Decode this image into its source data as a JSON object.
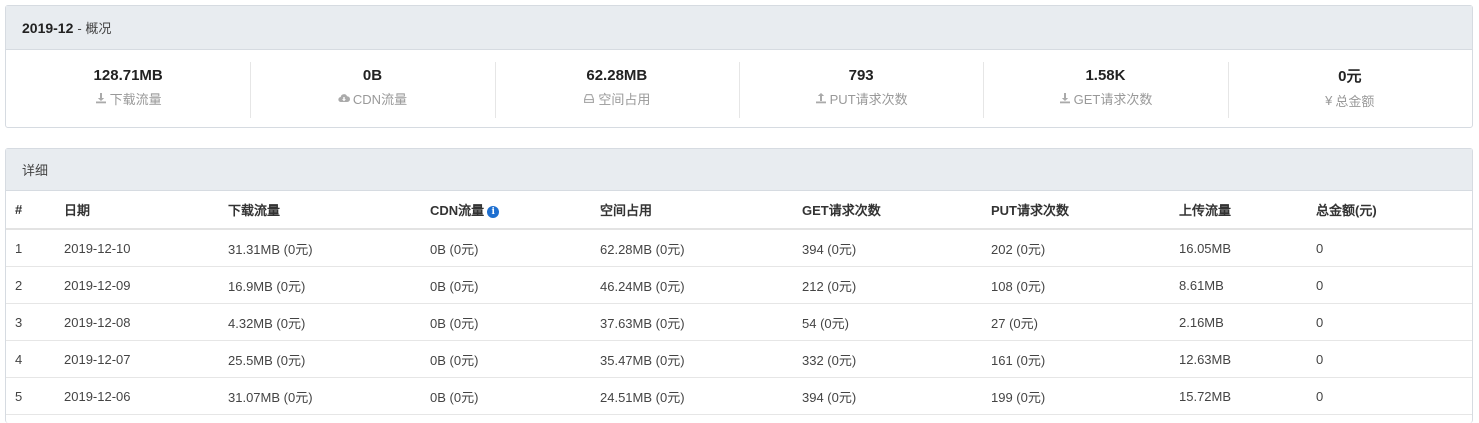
{
  "overview": {
    "month": "2019-12",
    "suffix": "- 概况",
    "stats": [
      {
        "value": "128.71MB",
        "label": "下载流量",
        "icon": "download-icon"
      },
      {
        "value": "0B",
        "label": "CDN流量",
        "icon": "cloud-download-icon"
      },
      {
        "value": "62.28MB",
        "label": "空间占用",
        "icon": "storage-icon"
      },
      {
        "value": "793",
        "label": "PUT请求次数",
        "icon": "upload-icon"
      },
      {
        "value": "1.58K",
        "label": "GET请求次数",
        "icon": "download-icon"
      },
      {
        "value": "0元",
        "label": "总金额",
        "icon": "yen-icon",
        "icon_glyph": "¥"
      }
    ]
  },
  "detail": {
    "title": "详细",
    "columns": [
      "#",
      "日期",
      "下载流量",
      "CDN流量",
      "空间占用",
      "GET请求次数",
      "PUT请求次数",
      "上传流量",
      "总金额(元)"
    ],
    "info_glyph": "i",
    "rows": [
      [
        "1",
        "2019-12-10",
        "31.31MB (0元)",
        "0B (0元)",
        "62.28MB (0元)",
        "394 (0元)",
        "202 (0元)",
        "16.05MB",
        "0"
      ],
      [
        "2",
        "2019-12-09",
        "16.9MB (0元)",
        "0B (0元)",
        "46.24MB (0元)",
        "212 (0元)",
        "108 (0元)",
        "8.61MB",
        "0"
      ],
      [
        "3",
        "2019-12-08",
        "4.32MB (0元)",
        "0B (0元)",
        "37.63MB (0元)",
        "54 (0元)",
        "27 (0元)",
        "2.16MB",
        "0"
      ],
      [
        "4",
        "2019-12-07",
        "25.5MB (0元)",
        "0B (0元)",
        "35.47MB (0元)",
        "332 (0元)",
        "161 (0元)",
        "12.63MB",
        "0"
      ],
      [
        "5",
        "2019-12-06",
        "31.07MB (0元)",
        "0B (0元)",
        "24.51MB (0元)",
        "394 (0元)",
        "199 (0元)",
        "15.72MB",
        "0"
      ]
    ]
  }
}
